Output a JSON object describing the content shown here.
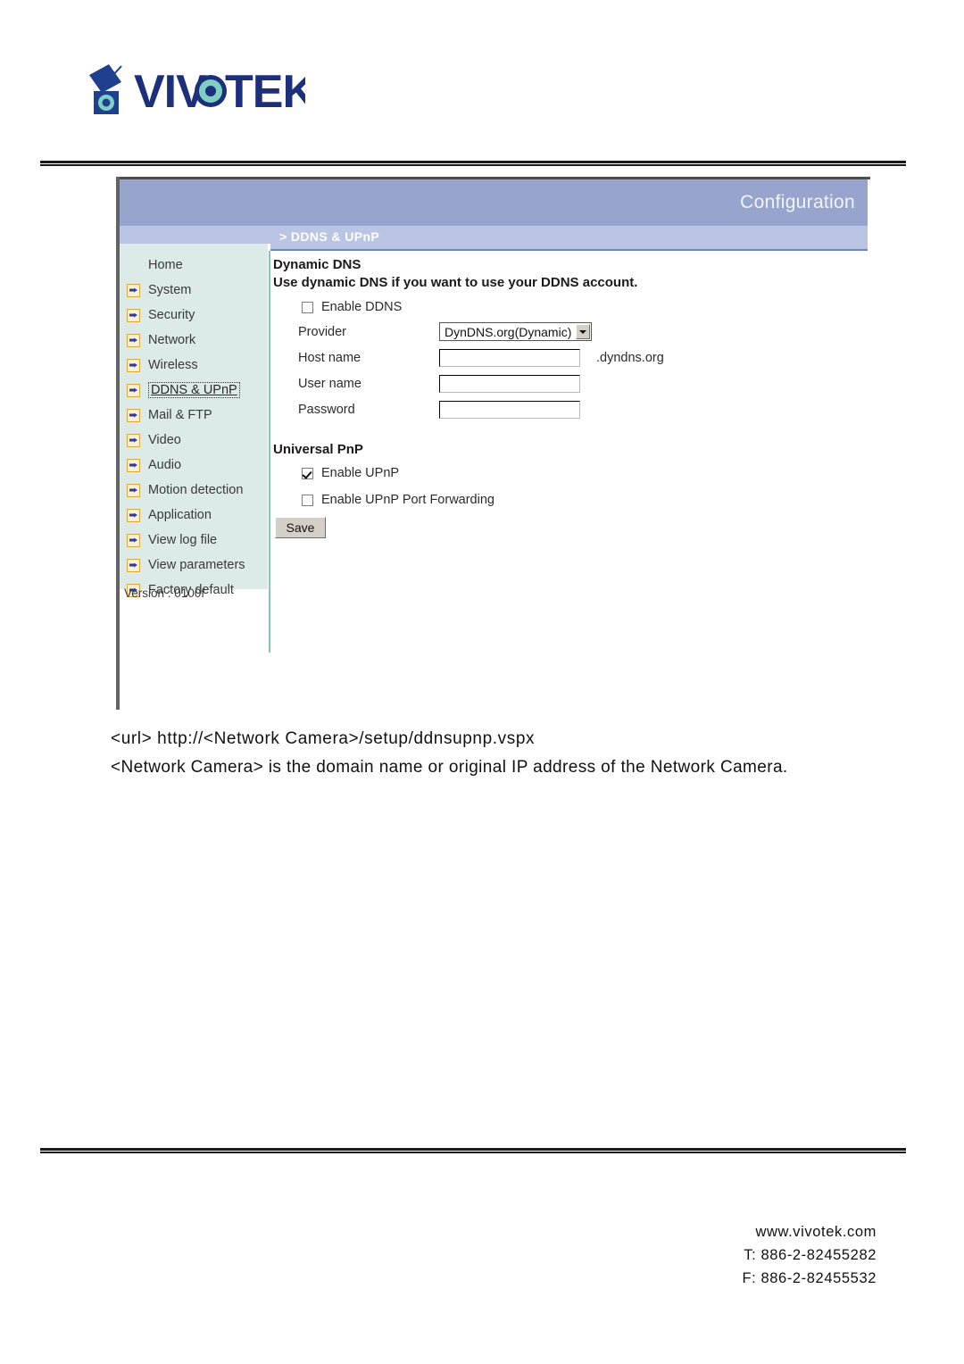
{
  "brand": {
    "name": "VIVOTEK",
    "logo_icon": "vivotek-camera-logo",
    "logo_primary_color": "#1b3a8c",
    "logo_accent_color": "#7fcfc2"
  },
  "camera_ui": {
    "banner_title": "Configuration",
    "banner_color": "#97a5ce",
    "banner_shade_color": "#b9c5e2",
    "breadcrumb": "> DDNS & UPnP",
    "sidebar": {
      "background_color": "#dcebe8",
      "divider_color": "#7fc8c0",
      "items": [
        {
          "label": "Home",
          "icon": "none",
          "selected": false
        },
        {
          "label": "System",
          "icon": "arrow-icon",
          "selected": false
        },
        {
          "label": "Security",
          "icon": "arrow-icon",
          "selected": false
        },
        {
          "label": "Network",
          "icon": "arrow-icon",
          "selected": false
        },
        {
          "label": "Wireless",
          "icon": "arrow-icon",
          "selected": false
        },
        {
          "label": "DDNS & UPnP",
          "icon": "arrow-icon",
          "selected": true
        },
        {
          "label": "Mail & FTP",
          "icon": "arrow-icon",
          "selected": false
        },
        {
          "label": "Video",
          "icon": "arrow-icon",
          "selected": false
        },
        {
          "label": "Audio",
          "icon": "arrow-icon",
          "selected": false
        },
        {
          "label": "Motion detection",
          "icon": "arrow-icon",
          "selected": false
        },
        {
          "label": "Application",
          "icon": "arrow-icon",
          "selected": false
        },
        {
          "label": "View log file",
          "icon": "arrow-icon",
          "selected": false
        },
        {
          "label": "View parameters",
          "icon": "arrow-icon",
          "selected": false
        },
        {
          "label": "Factory default",
          "icon": "arrow-icon",
          "selected": false
        }
      ],
      "version_text": "Version : 0100f"
    },
    "dynamic_dns": {
      "heading": "Dynamic DNS",
      "subheading": "Use dynamic DNS if you want to use your DDNS account.",
      "enable_ddns_label": "Enable DDNS",
      "enable_ddns_checked": false,
      "provider_label": "Provider",
      "provider_value": "DynDNS.org(Dynamic)",
      "host_name_label": "Host name",
      "host_name_value": "",
      "host_name_suffix": ".dyndns.org",
      "user_name_label": "User name",
      "user_name_value": "",
      "password_label": "Password",
      "password_value": ""
    },
    "universal_pnp": {
      "heading": "Universal PnP",
      "enable_upnp_label": "Enable UPnP",
      "enable_upnp_checked": true,
      "enable_port_forwarding_label": "Enable UPnP Port Forwarding",
      "enable_port_forwarding_checked": false,
      "save_label": "Save"
    }
  },
  "document": {
    "url_line": "<url> http://<Network Camera>/setup/ddnsupnp.vspx",
    "description": "<Network Camera> is the domain name or original IP address of the Network Camera."
  },
  "footer": {
    "website": "www.vivotek.com",
    "telephone": "T: 886-2-82455282",
    "fax": "F: 886-2-82455532"
  }
}
